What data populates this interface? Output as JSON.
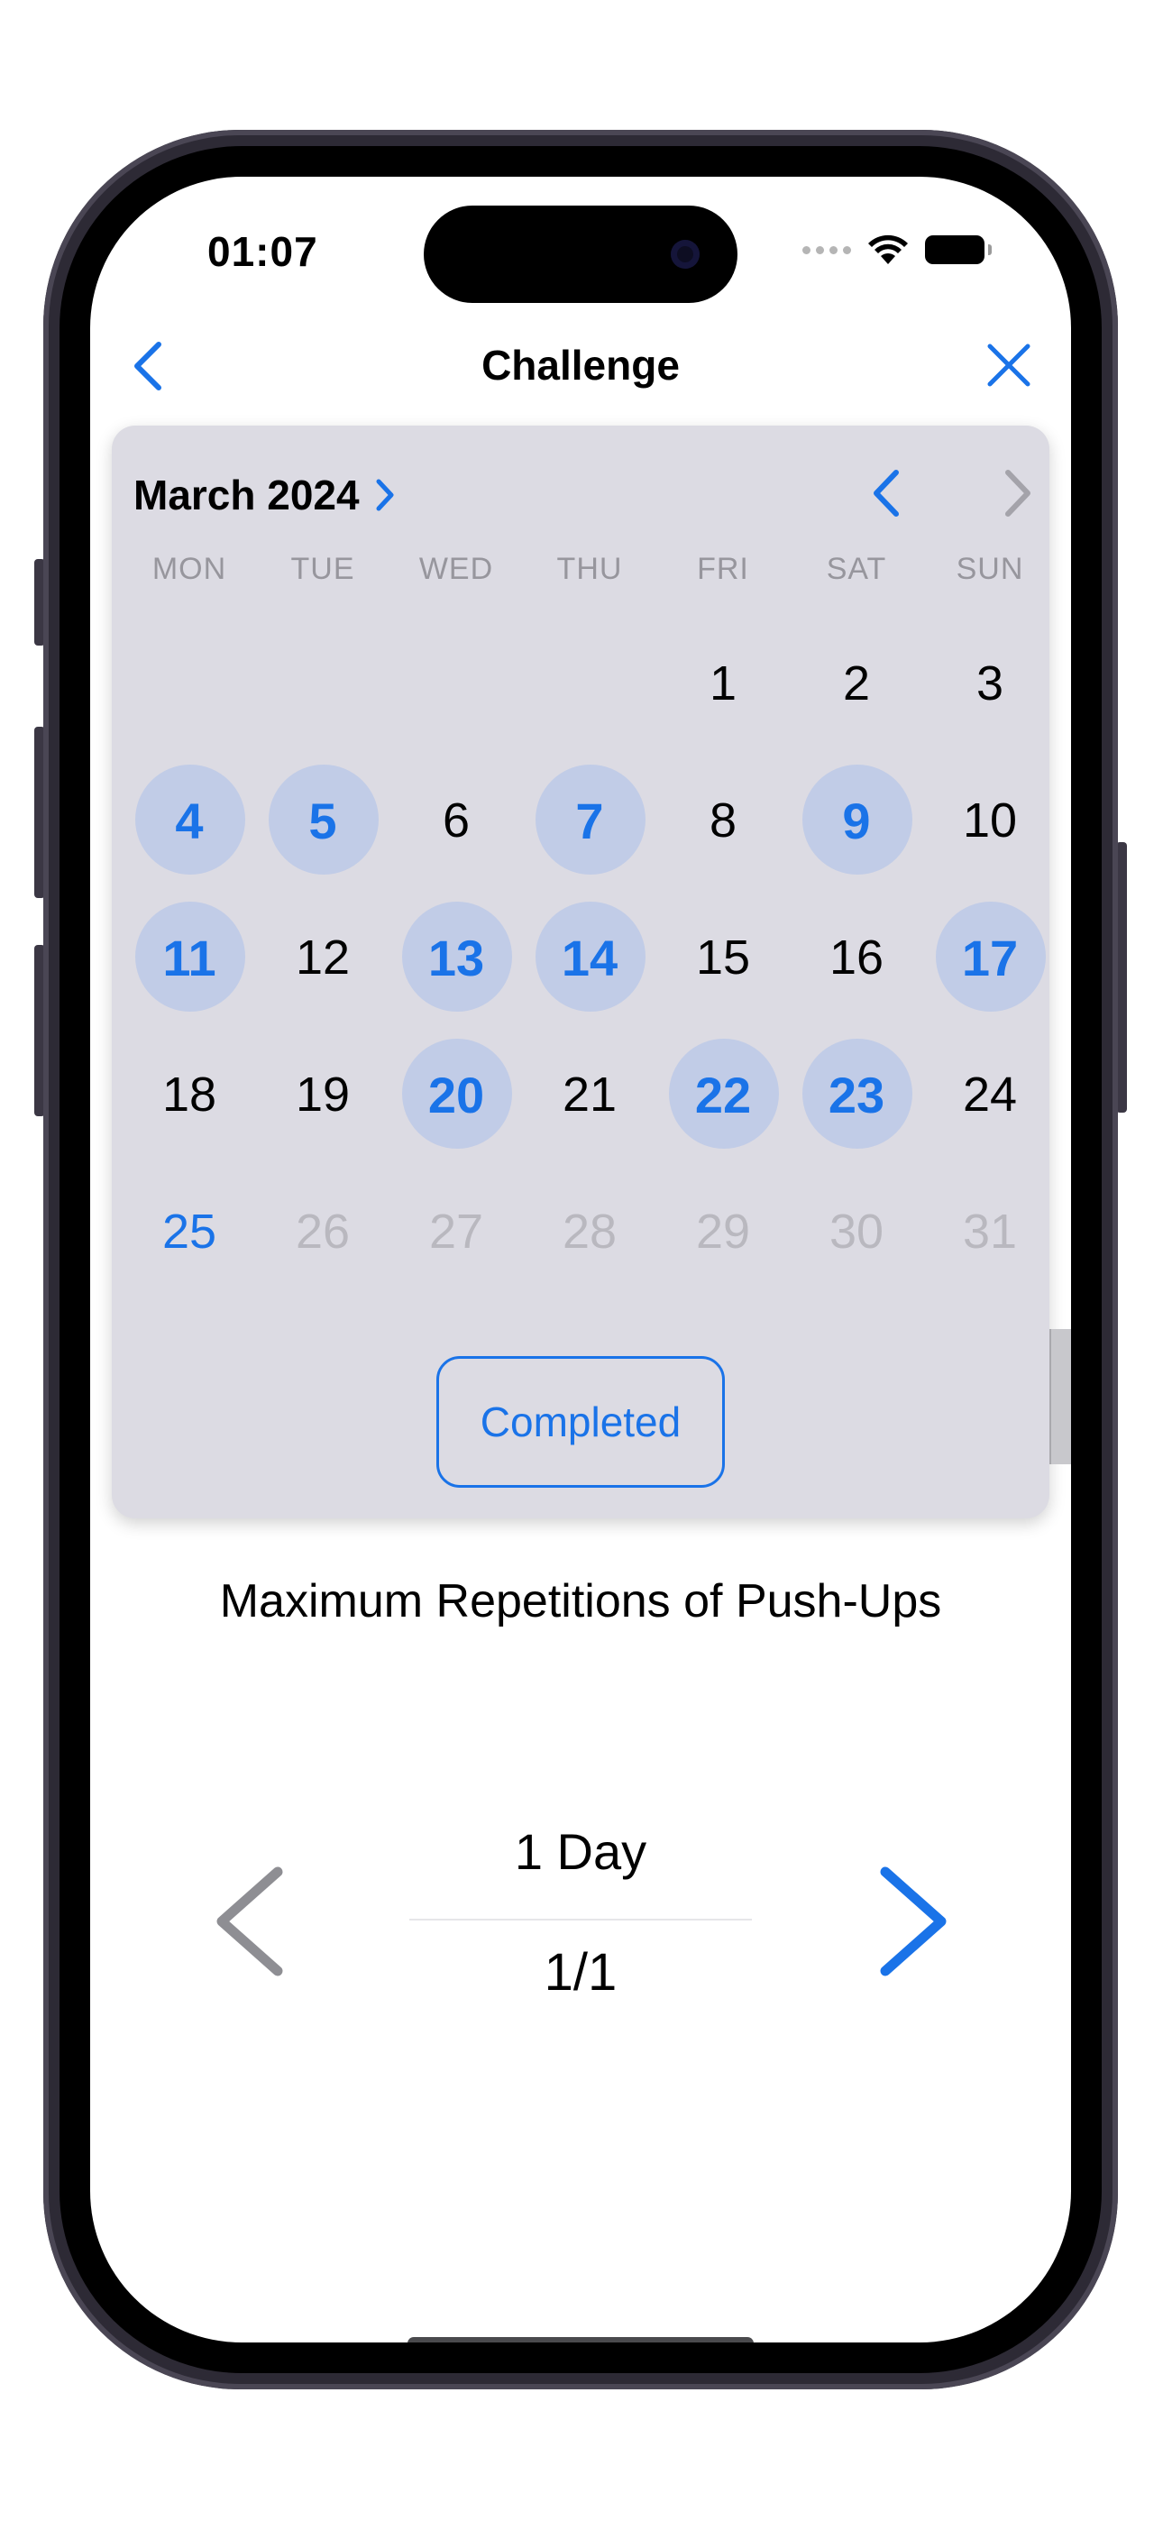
{
  "status_bar": {
    "time": "01:07"
  },
  "nav": {
    "title": "Challenge"
  },
  "calendar": {
    "month_label": "March 2024",
    "weekdays": [
      "MON",
      "TUE",
      "WED",
      "THU",
      "FRI",
      "SAT",
      "SUN"
    ],
    "weeks": [
      [
        {
          "d": ""
        },
        {
          "d": ""
        },
        {
          "d": ""
        },
        {
          "d": ""
        },
        {
          "d": "1"
        },
        {
          "d": "2"
        },
        {
          "d": "3"
        }
      ],
      [
        {
          "d": "4",
          "s": "marked"
        },
        {
          "d": "5",
          "s": "marked"
        },
        {
          "d": "6"
        },
        {
          "d": "7",
          "s": "marked"
        },
        {
          "d": "8"
        },
        {
          "d": "9",
          "s": "marked"
        },
        {
          "d": "10"
        }
      ],
      [
        {
          "d": "11",
          "s": "marked"
        },
        {
          "d": "12"
        },
        {
          "d": "13",
          "s": "marked"
        },
        {
          "d": "14",
          "s": "marked"
        },
        {
          "d": "15"
        },
        {
          "d": "16"
        },
        {
          "d": "17",
          "s": "marked"
        }
      ],
      [
        {
          "d": "18"
        },
        {
          "d": "19"
        },
        {
          "d": "20",
          "s": "marked"
        },
        {
          "d": "21"
        },
        {
          "d": "22",
          "s": "marked"
        },
        {
          "d": "23",
          "s": "marked"
        },
        {
          "d": "24"
        }
      ],
      [
        {
          "d": "25",
          "s": "today"
        },
        {
          "d": "26",
          "s": "future"
        },
        {
          "d": "27",
          "s": "future"
        },
        {
          "d": "28",
          "s": "future"
        },
        {
          "d": "29",
          "s": "future"
        },
        {
          "d": "30",
          "s": "future"
        },
        {
          "d": "31",
          "s": "future"
        }
      ]
    ],
    "completed_button": "Completed",
    "accent_color": "#1a73e8",
    "marked_fill": "#c1cce7"
  },
  "exercise": {
    "title": "Maximum Repetitions of Push-Ups"
  },
  "pager": {
    "day_label": "1 Day",
    "count": "1/1",
    "prev_enabled": false,
    "next_enabled": true
  }
}
